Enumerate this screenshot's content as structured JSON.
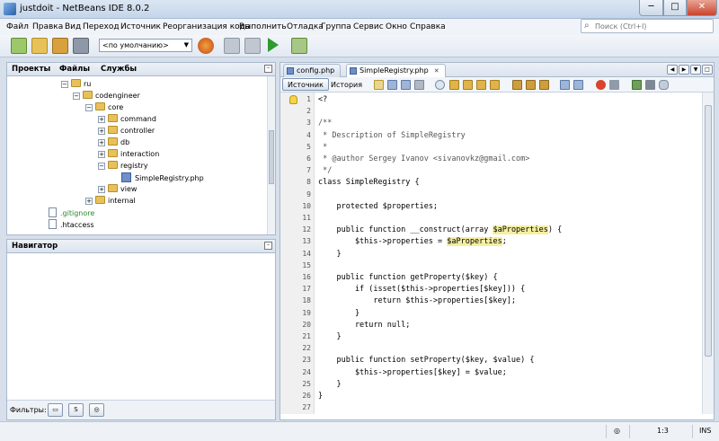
{
  "window": {
    "title": "justdoit - NetBeans IDE 8.0.2",
    "min": "─",
    "max": "□",
    "close": "✕"
  },
  "menu": [
    "Файл",
    "Правка",
    "Вид",
    "Переход",
    "Источник",
    "Реорганизация кода",
    "Выполнить",
    "Отладка",
    "Группа",
    "Сервис",
    "Окно",
    "Справка"
  ],
  "search": {
    "placeholder": "Поиск (Ctrl+I)"
  },
  "toolbar": {
    "config": "<по умолчанию>"
  },
  "left_tabs": [
    "Проекты",
    "Файлы",
    "Службы"
  ],
  "tree": [
    {
      "label": "ru",
      "type": "folder"
    },
    {
      "label": "codengineer",
      "type": "folder"
    },
    {
      "label": "core",
      "type": "folder"
    },
    {
      "label": "command",
      "type": "folder"
    },
    {
      "label": "controller",
      "type": "folder"
    },
    {
      "label": "db",
      "type": "folder"
    },
    {
      "label": "interaction",
      "type": "folder"
    },
    {
      "label": "registry",
      "type": "folder"
    },
    {
      "label": "SimpleRegistry.php",
      "type": "php"
    },
    {
      "label": "view",
      "type": "folder"
    },
    {
      "label": "internal",
      "type": "folder"
    },
    {
      "label": ".gitignore",
      "type": "file"
    },
    {
      "label": ".htaccess",
      "type": "file"
    }
  ],
  "navigator": {
    "title": "Навигатор",
    "filters_label": "Фильтры:"
  },
  "editor": {
    "tabs": [
      "config.php",
      "SimpleRegistry.php"
    ],
    "source_btn": "Источник",
    "history_btn": "История",
    "lines": [
      "<?",
      "",
      "/**",
      " * Description of SimpleRegistry",
      " *",
      " * @author Sergey Ivanov <sivanovkz@gmail.com>",
      " */",
      "class SimpleRegistry {",
      "",
      "    protected $properties;",
      "",
      "    public function __construct(array $aProperties) {",
      "        $this->properties = $aProperties;",
      "    }",
      "",
      "    public function getProperty($key) {",
      "        if (isset($this->properties[$key])) {",
      "            return $this->properties[$key];",
      "        }",
      "        return null;",
      "    }",
      "",
      "    public function setProperty($key, $value) {",
      "        $this->properties[$key] = $value;",
      "    }",
      "}",
      ""
    ]
  },
  "status": {
    "position": "1:3",
    "mode": "INS"
  }
}
